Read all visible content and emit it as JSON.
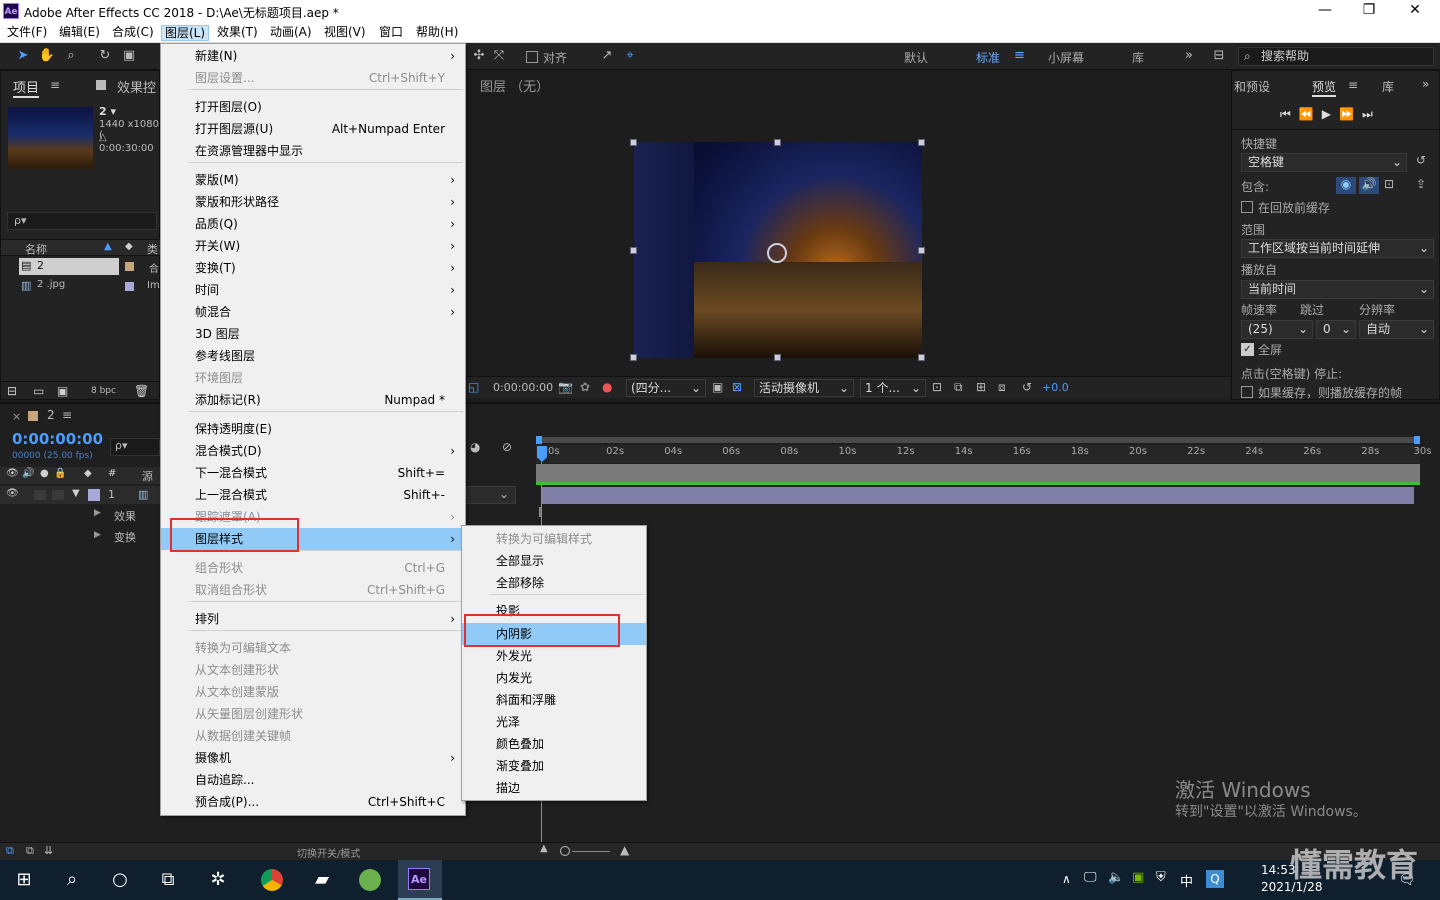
{
  "titlebar": {
    "logo": "Ae",
    "title": "Adobe After Effects CC 2018 - D:\\Ae\\无标题项目.aep *",
    "minimize": "—",
    "maximize": "❐",
    "close": "✕"
  },
  "menubar": [
    "文件(F)",
    "编辑(E)",
    "合成(C)",
    "图层(L)",
    "效果(T)",
    "动画(A)",
    "视图(V)",
    "窗口",
    "帮助(H)"
  ],
  "toolbar": {
    "align_label": "对齐",
    "workspaces": [
      "默认",
      "标准",
      "小屏幕",
      "库"
    ],
    "search_help": "搜索帮助"
  },
  "project": {
    "tab_project": "项目",
    "tab_effects": "效果控",
    "comp_name": "2 ▾",
    "comp_size": "1440 x1080 (",
    "comp_dur": "△ 0:00:30:00",
    "search_icon_text": "ρ▾",
    "col_name": "名称",
    "col_type": "类",
    "rows": [
      {
        "name": "2",
        "type": "合"
      },
      {
        "name": "2 .jpg",
        "type": "Im"
      }
    ],
    "bpc": "8 bpc"
  },
  "viewer": {
    "header": "图层 （无）",
    "timecode": "0:00:00:00",
    "zoom": "(四分...",
    "camera": "活动摄像机",
    "views": "1 个...",
    "offset": "+0.0"
  },
  "preview": {
    "tab_presets": "和预设",
    "tab_preview": "预览",
    "tab_lib": "库",
    "shortcut_label": "快捷键",
    "shortcut_value": "空格键",
    "include_label": "包含:",
    "cache_label": "在回放前缓存",
    "range_label": "范围",
    "range_value": "工作区域按当前时间延伸",
    "play_from_label": "播放自",
    "play_from_value": "当前时间",
    "fps_label": "帧速率",
    "skip_label": "跳过",
    "res_label": "分辨率",
    "fps_value": "(25)",
    "skip_value": "0",
    "res_value": "自动",
    "fullscreen_label": "全屏",
    "stop_label": "点击(空格键) 停止:",
    "stop_option": "如果缓存，则播放缓存的帧"
  },
  "timeline": {
    "comp_tab": "2",
    "timecode": "0:00:00:00",
    "frames": "00000 (25.00 fps)",
    "col_src": "源",
    "layer_num": "1",
    "sub_effects": "效果",
    "sub_transform": "变换",
    "ruler": [
      "0s",
      "02s",
      "04s",
      "06s",
      "08s",
      "10s",
      "12s",
      "14s",
      "16s",
      "18s",
      "20s",
      "22s",
      "24s",
      "26s",
      "28s",
      "30s"
    ],
    "cursor": "I"
  },
  "statusbar": {
    "toggle": "切换开关/模式"
  },
  "layer_menu": {
    "items": [
      {
        "label": "新建(N)",
        "shortcut": "",
        "sub": true,
        "disabled": false
      },
      {
        "label": "图层设置...",
        "shortcut": "Ctrl+Shift+Y",
        "sub": false,
        "disabled": true
      },
      {
        "label": "打开图层(O)",
        "shortcut": "",
        "sub": false,
        "disabled": false
      },
      {
        "label": "打开图层源(U)",
        "shortcut": "Alt+Numpad Enter",
        "sub": false,
        "disabled": false
      },
      {
        "label": "在资源管理器中显示",
        "shortcut": "",
        "sub": false,
        "disabled": false
      },
      {
        "label": "蒙版(M)",
        "shortcut": "",
        "sub": true,
        "disabled": false
      },
      {
        "label": "蒙版和形状路径",
        "shortcut": "",
        "sub": true,
        "disabled": false
      },
      {
        "label": "品质(Q)",
        "shortcut": "",
        "sub": true,
        "disabled": false
      },
      {
        "label": "开关(W)",
        "shortcut": "",
        "sub": true,
        "disabled": false
      },
      {
        "label": "变换(T)",
        "shortcut": "",
        "sub": true,
        "disabled": false
      },
      {
        "label": "时间",
        "shortcut": "",
        "sub": true,
        "disabled": false
      },
      {
        "label": "帧混合",
        "shortcut": "",
        "sub": true,
        "disabled": false
      },
      {
        "label": "3D 图层",
        "shortcut": "",
        "sub": false,
        "disabled": false
      },
      {
        "label": "参考线图层",
        "shortcut": "",
        "sub": false,
        "disabled": false
      },
      {
        "label": "环境图层",
        "shortcut": "",
        "sub": false,
        "disabled": true
      },
      {
        "label": "添加标记(R)",
        "shortcut": "Numpad *",
        "sub": false,
        "disabled": false
      },
      {
        "label": "保持透明度(E)",
        "shortcut": "",
        "sub": false,
        "disabled": false
      },
      {
        "label": "混合模式(D)",
        "shortcut": "",
        "sub": true,
        "disabled": false
      },
      {
        "label": "下一混合模式",
        "shortcut": "Shift+=",
        "sub": false,
        "disabled": false
      },
      {
        "label": "上一混合模式",
        "shortcut": "Shift+-",
        "sub": false,
        "disabled": false
      },
      {
        "label": "跟踪遮罩(A)",
        "shortcut": "",
        "sub": true,
        "disabled": true
      },
      {
        "label": "图层样式",
        "shortcut": "",
        "sub": true,
        "disabled": false
      },
      {
        "label": "组合形状",
        "shortcut": "Ctrl+G",
        "sub": false,
        "disabled": true
      },
      {
        "label": "取消组合形状",
        "shortcut": "Ctrl+Shift+G",
        "sub": false,
        "disabled": true
      },
      {
        "label": "排列",
        "shortcut": "",
        "sub": true,
        "disabled": false
      },
      {
        "label": "转换为可编辑文本",
        "shortcut": "",
        "sub": false,
        "disabled": true
      },
      {
        "label": "从文本创建形状",
        "shortcut": "",
        "sub": false,
        "disabled": true
      },
      {
        "label": "从文本创建蒙版",
        "shortcut": "",
        "sub": false,
        "disabled": true
      },
      {
        "label": "从矢量图层创建形状",
        "shortcut": "",
        "sub": false,
        "disabled": true
      },
      {
        "label": "从数据创建关键帧",
        "shortcut": "",
        "sub": false,
        "disabled": true
      },
      {
        "label": "摄像机",
        "shortcut": "",
        "sub": true,
        "disabled": false
      },
      {
        "label": "自动追踪...",
        "shortcut": "",
        "sub": false,
        "disabled": false
      },
      {
        "label": "预合成(P)...",
        "shortcut": "Ctrl+Shift+C",
        "sub": false,
        "disabled": false
      }
    ]
  },
  "style_menu": {
    "items": [
      {
        "label": "转换为可编辑样式",
        "disabled": true
      },
      {
        "label": "全部显示",
        "disabled": false
      },
      {
        "label": "全部移除",
        "disabled": false
      },
      {
        "label": "投影",
        "disabled": false
      },
      {
        "label": "内阴影",
        "disabled": false
      },
      {
        "label": "外发光",
        "disabled": false
      },
      {
        "label": "内发光",
        "disabled": false
      },
      {
        "label": "斜面和浮雕",
        "disabled": false
      },
      {
        "label": "光泽",
        "disabled": false
      },
      {
        "label": "颜色叠加",
        "disabled": false
      },
      {
        "label": "渐变叠加",
        "disabled": false
      },
      {
        "label": "描边",
        "disabled": false
      }
    ]
  },
  "watermark": {
    "line1": "激活 Windows",
    "line2": "转到\"设置\"以激活 Windows。",
    "brand": "懂需教育"
  },
  "taskbar": {
    "time": "14:53",
    "date": "2021/1/28",
    "ime": "中",
    "ae_label": "Ae"
  }
}
